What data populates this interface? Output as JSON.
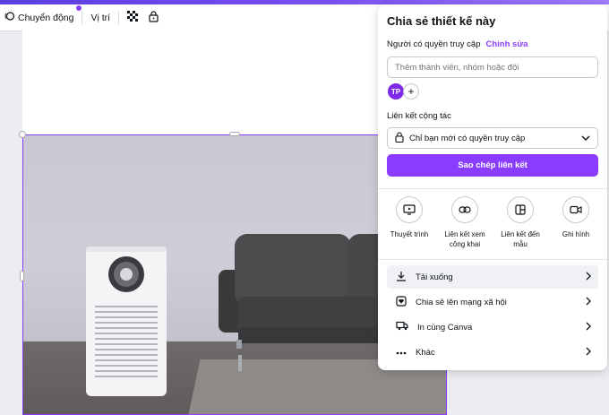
{
  "toolbar": {
    "animate_label": "Chuyển động",
    "position_label": "Vị trí"
  },
  "share_panel": {
    "title": "Chia sẻ thiết kế này",
    "access_label": "Người có quyền truy cập",
    "edit_link": "Chỉnh sửa",
    "member_input_placeholder": "Thêm thành viên, nhóm hoặc đội",
    "avatar_initials": "TP",
    "add_symbol": "+",
    "collab_link_label": "Liên kết cộng tác",
    "access_value": "Chỉ bạn mới có quyền truy cập",
    "copy_link_button": "Sao chép liên kết",
    "actions": [
      {
        "label": "Thuyết trình",
        "icon": "present-icon"
      },
      {
        "label": "Liên kết xem công khai",
        "icon": "link-icon"
      },
      {
        "label": "Liên kết đến mẫu",
        "icon": "template-icon"
      },
      {
        "label": "Ghi hình",
        "icon": "record-icon"
      }
    ],
    "menu": [
      {
        "label": "Tải xuống",
        "icon": "download-icon"
      },
      {
        "label": "Chia sẻ lên mạng xã hội",
        "icon": "heart-icon"
      },
      {
        "label": "In cùng Canva",
        "icon": "truck-icon"
      },
      {
        "label": "Khác",
        "icon": "more-icon"
      }
    ]
  },
  "colors": {
    "accent": "#8b3dff",
    "avatar": "#7d2ae8"
  }
}
